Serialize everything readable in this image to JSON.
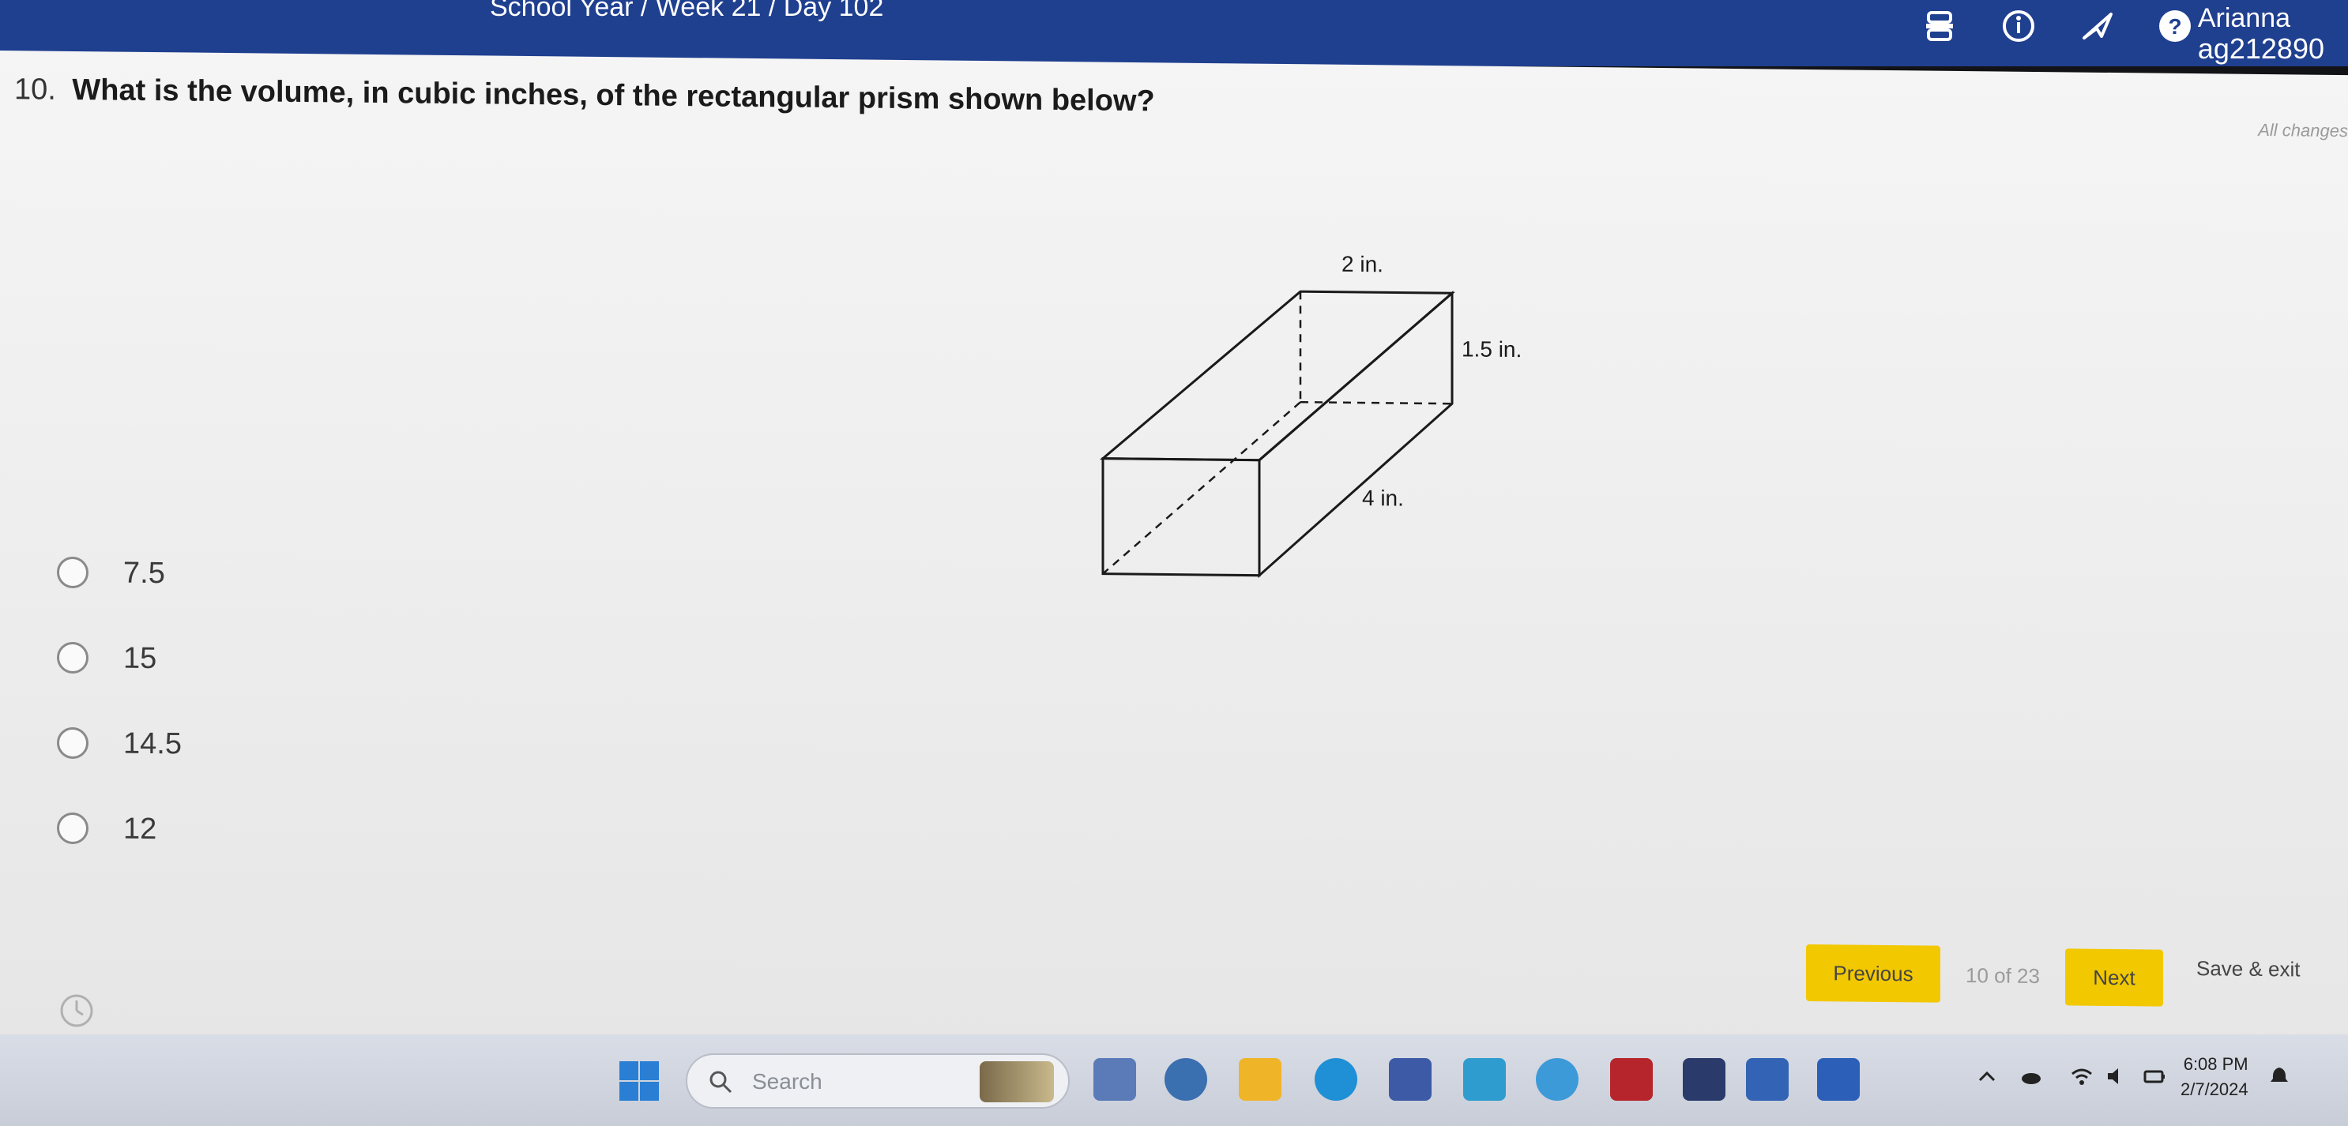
{
  "header": {
    "breadcrumb": "School Year / Week 21 / Day 102",
    "user_name": "Arianna",
    "user_id": "ag212890",
    "icons": [
      "print-icon",
      "info-icon",
      "flag-icon",
      "help-icon"
    ]
  },
  "question": {
    "number": "10.",
    "text": "What is the volume, in cubic inches, of the rectangular prism shown below?",
    "autosave_text": "All changes",
    "diagram": {
      "top_label": "2 in.",
      "side_label": "1.5 in.",
      "length_label": "4 in."
    },
    "choices": [
      "7.5",
      "15",
      "14.5",
      "12"
    ]
  },
  "nav": {
    "previous_label": "Previous",
    "counter": "10 of 23",
    "next_label": "Next",
    "save_exit_label": "Save & exit"
  },
  "taskbar": {
    "search_placeholder": "Search",
    "time": "6:08 PM",
    "date": "2/7/2024"
  },
  "colors": {
    "header_bg": "#1f3f8f",
    "button_yellow": "#f2c800"
  }
}
